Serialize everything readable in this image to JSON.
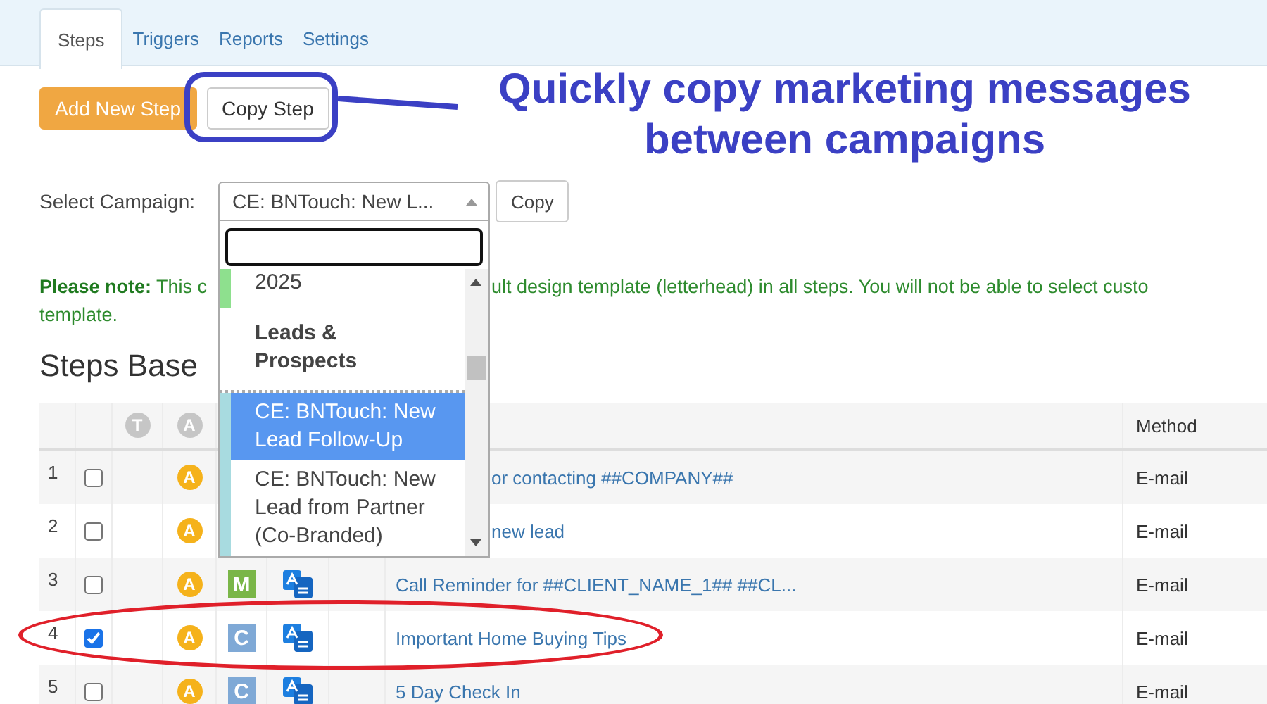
{
  "tabs": [
    {
      "label": "Steps",
      "selected": true
    },
    {
      "label": "Triggers",
      "selected": false
    },
    {
      "label": "Reports",
      "selected": false
    },
    {
      "label": "Settings",
      "selected": false
    }
  ],
  "toolbar": {
    "buttons": [
      {
        "label": "Add New Step",
        "kind": "primary"
      },
      {
        "label": "Copy Step",
        "kind": "default"
      }
    ]
  },
  "callout": {
    "lines": [
      "Quickly copy marketing messages",
      "between campaigns"
    ]
  },
  "campaign_select": {
    "label": "Select Campaign:",
    "value": "CE: BNTouch: New L...",
    "button": "Copy",
    "expanded": true,
    "options": [
      {
        "kind": "option",
        "label": "2025",
        "color": "#8ee08e",
        "selected": false
      },
      {
        "kind": "group",
        "label": "Leads & Prospects"
      },
      {
        "kind": "option",
        "label": "CE: BNTouch: New Lead Follow-Up",
        "color": "#a8dbe0",
        "selected": true
      },
      {
        "kind": "option",
        "label": "CE: BNTouch: New Lead from Partner (Co-Branded)",
        "color": "#a8dbe0",
        "selected": false
      }
    ]
  },
  "note": {
    "parts": [
      "**Please note:** This c",
      "ult design template (letterhead) in all steps. You will not be able to select custo",
      "template."
    ]
  },
  "heading": "Steps Base",
  "table": {
    "header_icons": [
      "T",
      "A"
    ],
    "columns": [
      {
        "label": "Method"
      }
    ],
    "rows": [
      {
        "number": "1",
        "checked": false,
        "badge": "A",
        "title": "or contacting ##COMPANY##",
        "method": "E-mail"
      },
      {
        "number": "2",
        "checked": false,
        "badge": "A",
        "title": "new lead",
        "method": "E-mail"
      },
      {
        "number": "3",
        "checked": false,
        "badge": "A",
        "type": {
          "letter": "M",
          "color": "#7ab648"
        },
        "title": "Call Reminder for ##CLIENT_NAME_1## ##CL...",
        "method": "E-mail"
      },
      {
        "number": "4",
        "checked": true,
        "badge": "A",
        "type": {
          "letter": "C",
          "color": "#7fa9d6"
        },
        "title": "Important Home Buying Tips",
        "method": "E-mail"
      },
      {
        "number": "5",
        "checked": false,
        "badge": "A",
        "type": {
          "letter": "C",
          "color": "#7fa9d6"
        },
        "title": "5 Day Check In",
        "method": "E-mail"
      }
    ]
  }
}
